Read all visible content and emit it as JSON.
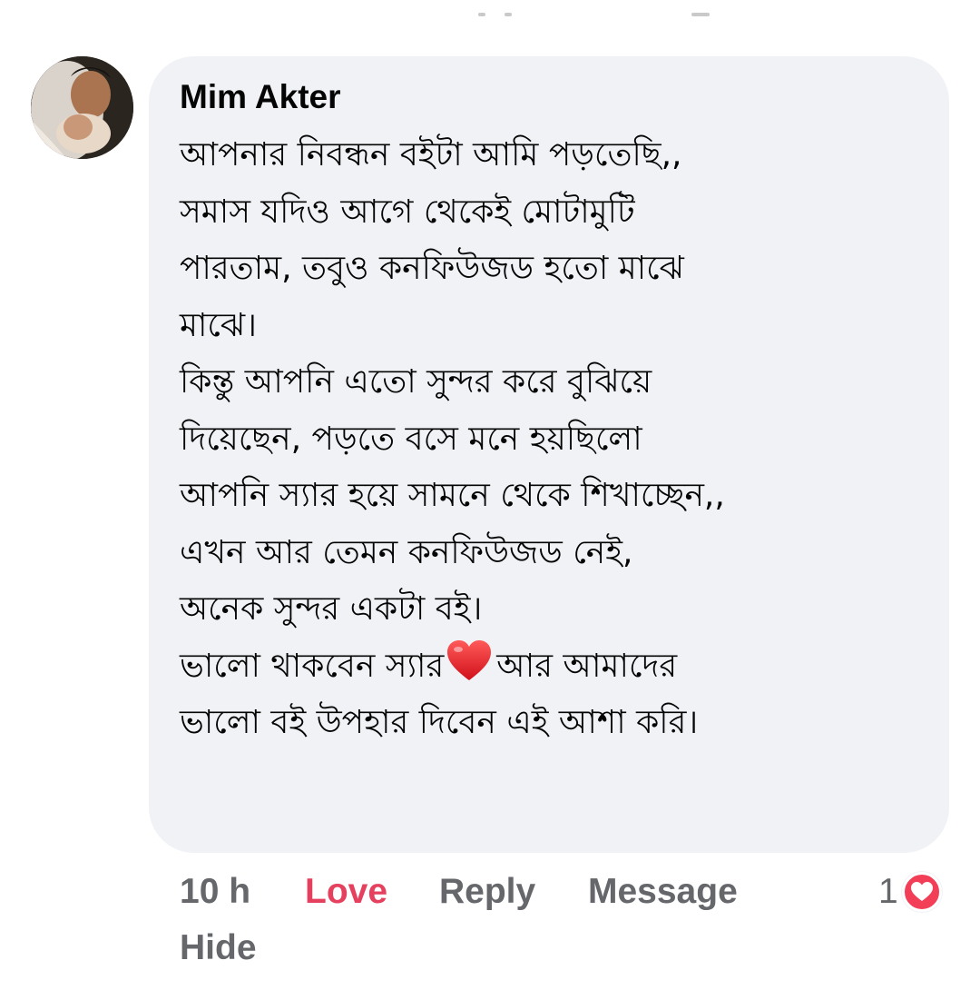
{
  "comment": {
    "author": "Mim Akter",
    "avatar": "avatar-photo",
    "body_lines": [
      "আপনার নিবন্ধন বইটা আমি পড়তেছি,,",
      "সমাস যদিও আগে থেকেই মোটামুটি",
      "পারতাম, তবুও কনফিউজড হতো মাঝে",
      "মাঝে।",
      "কিন্তু আপনি এতো সুন্দর করে বুঝিয়ে",
      "দিয়েছেন, পড়তে বসে মনে হয়ছিলো",
      "আপনি স্যার হয়ে সামনে থেকে শিখাচ্ছেন,,",
      "এখন আর তেমন কনফিউজড নেই,",
      "অনেক সুন্দর একটা বই।"
    ],
    "line_10_before_emoji": "ভালো থাকবেন স্যার",
    "emoji": "red-heart-emoji",
    "line_10_after_emoji": "আর আমাদের",
    "line_11": "ভালো বই উপহার দিবেন এই আশা করি।"
  },
  "actions": {
    "time": "10 h",
    "love": "Love",
    "reply": "Reply",
    "message": "Message",
    "hide": "Hide"
  },
  "reaction": {
    "count": "1",
    "icon": "love-reaction-icon"
  },
  "colors": {
    "bubble_bg": "#f0f2f5",
    "text": "#050505",
    "secondary": "#65676b",
    "love_active": "#e5415e",
    "reaction_love": "#f33e58"
  }
}
